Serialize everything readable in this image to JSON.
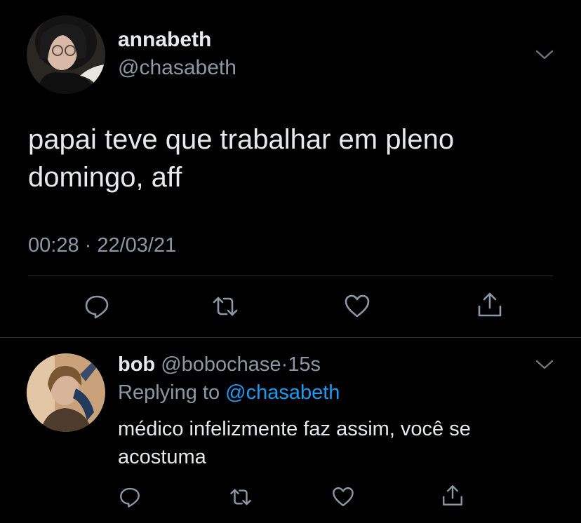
{
  "main_tweet": {
    "display_name": "annabeth",
    "handle": "@chasabeth",
    "text": "papai teve que trabalhar em pleno domingo, aff",
    "time": "00:28",
    "separator": " · ",
    "date": "22/03/21",
    "icons": [
      "reply-icon",
      "retweet-icon",
      "like-icon",
      "share-icon",
      "chevron-down-icon"
    ]
  },
  "reply_tweet": {
    "display_name": "bob",
    "handle": "@bobochase",
    "dot": "·",
    "time": "15s",
    "replying_prefix": "Replying to",
    "replying_handle": "@chasabeth",
    "text": "médico infelizmente faz assim, você se acostuma",
    "icons": [
      "reply-icon",
      "retweet-icon",
      "like-icon",
      "share-icon",
      "chevron-down-icon"
    ]
  },
  "colors": {
    "background": "#000000",
    "primary_text": "#e7e9ea",
    "secondary_text": "#8b98a5",
    "link": "#1d9bf0",
    "divider": "#2f3336"
  }
}
